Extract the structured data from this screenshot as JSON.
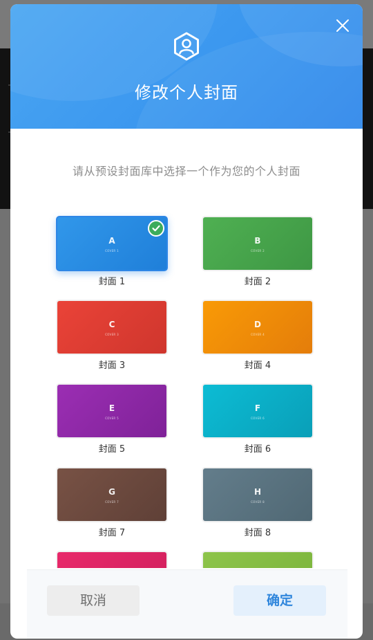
{
  "modal": {
    "title": "修改个人封面",
    "subtitle": "请从预设封面库中选择一个作为您的个人封面",
    "close_icon": "close-icon",
    "header_icon": "user-hexagon-icon",
    "header_color": "#3b97ef"
  },
  "covers": [
    {
      "letter": "A",
      "caption": "COVER 1",
      "label": "封面 1",
      "color": "#2a8be3",
      "selected": true
    },
    {
      "letter": "B",
      "caption": "COVER 2",
      "label": "封面 2",
      "color": "#46a34c",
      "selected": false
    },
    {
      "letter": "C",
      "caption": "COVER 3",
      "label": "封面 3",
      "color": "#e03d33",
      "selected": false
    },
    {
      "letter": "D",
      "caption": "COVER 4",
      "label": "封面 4",
      "color": "#f28a08",
      "selected": false
    },
    {
      "letter": "E",
      "caption": "COVER 5",
      "label": "封面 5",
      "color": "#8e2aa6",
      "selected": false
    },
    {
      "letter": "F",
      "caption": "COVER 6",
      "label": "封面 6",
      "color": "#0aaec8",
      "selected": false
    },
    {
      "letter": "G",
      "caption": "COVER 7",
      "label": "封面 7",
      "color": "#6c4a3e",
      "selected": false
    },
    {
      "letter": "H",
      "caption": "COVER 8",
      "label": "封面 8",
      "color": "#5b7482",
      "selected": false
    },
    {
      "letter": "",
      "caption": "",
      "label": "",
      "color": "#e02565",
      "selected": false
    },
    {
      "letter": "",
      "caption": "",
      "label": "",
      "color": "#86bd45",
      "selected": false
    }
  ],
  "footer": {
    "cancel_label": "取消",
    "confirm_label": "确定"
  }
}
